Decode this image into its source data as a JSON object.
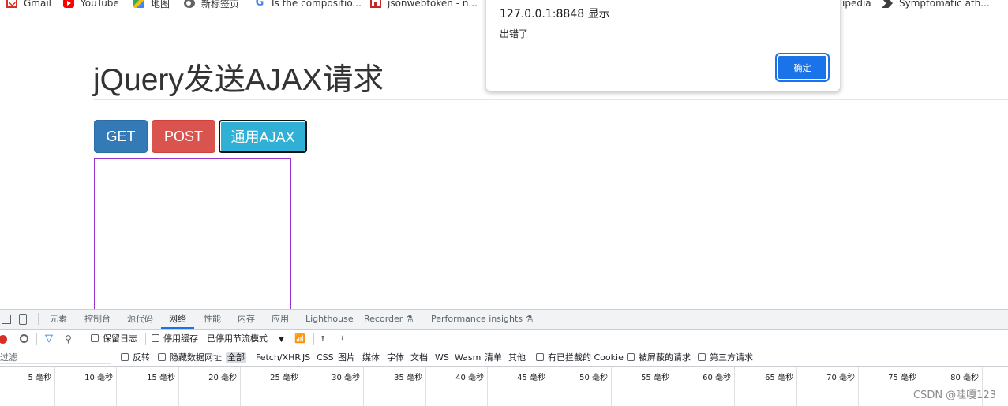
{
  "bookmarks": [
    {
      "label": "Gmail",
      "icon": "gmail-icon"
    },
    {
      "label": "YouTube",
      "icon": "youtube-icon"
    },
    {
      "label": "地图",
      "icon": "maps-icon"
    },
    {
      "label": "新标签页",
      "icon": "globe-icon"
    },
    {
      "label": "Is the compositio...",
      "icon": "google-icon"
    },
    {
      "label": "jsonwebtoken - n...",
      "icon": "npm-icon"
    },
    {
      "label": "ipedia",
      "icon": "wikipedia-icon"
    },
    {
      "label": "Symptomatic ath...",
      "icon": "arrow-icon"
    }
  ],
  "page": {
    "title": "jQuery发送AJAX请求",
    "buttons": {
      "get": "GET",
      "post": "POST",
      "ajax": "通用AJAX"
    },
    "result_border_color": "#9932cc"
  },
  "dialog": {
    "origin": "127.0.0.1:8848 显示",
    "message": "出错了",
    "ok_label": "确定"
  },
  "devtools": {
    "tabs": [
      "元素",
      "控制台",
      "源代码",
      "网络",
      "性能",
      "内存",
      "应用",
      "Lighthouse",
      "Recorder ⚗",
      "Performance insights ⚗"
    ],
    "active_tab": "网络",
    "toolbar": {
      "preserve_log": "保留日志",
      "disable_cache": "停用缓存",
      "throttle": "已停用节流模式"
    },
    "filter": {
      "placeholder": "过滤",
      "invert": "反转",
      "hide_data_urls": "隐藏数据网址",
      "types": [
        "全部",
        "Fetch/XHR",
        "JS",
        "CSS",
        "图片",
        "媒体",
        "字体",
        "文档",
        "WS",
        "Wasm",
        "清单",
        "其他"
      ],
      "active_type": "全部",
      "blocked_cookies": "有已拦截的 Cookie",
      "blocked_requests": "被屏蔽的请求",
      "third_party": "第三方请求"
    },
    "timeline_ticks": [
      "5 毫秒",
      "10 毫秒",
      "15 毫秒",
      "20 毫秒",
      "25 毫秒",
      "30 毫秒",
      "35 毫秒",
      "40 毫秒",
      "45 毫秒",
      "50 毫秒",
      "55 毫秒",
      "60 毫秒",
      "65 毫秒",
      "70 毫秒",
      "75 毫秒",
      "80 毫秒"
    ]
  },
  "watermark": "CSDN @哇嘎123"
}
